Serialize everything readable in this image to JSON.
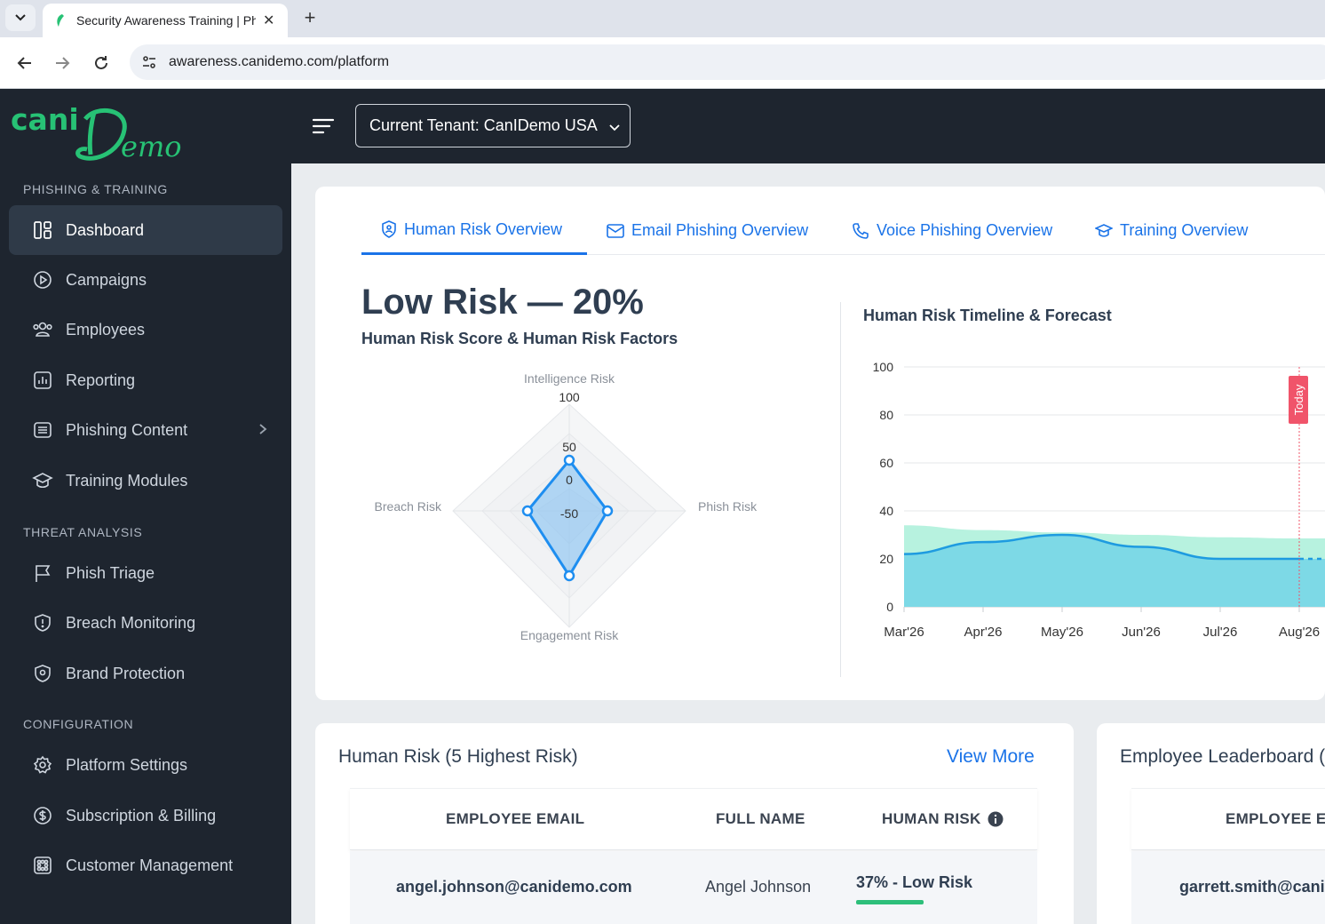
{
  "browser": {
    "tab_title": "Security Awareness Training | Ph",
    "url": "awareness.canidemo.com/platform"
  },
  "header": {
    "logo_text_left": "cani",
    "logo_text_right": "Demo",
    "tenant_label": "Current Tenant: CanIDemo USA"
  },
  "sidebar": {
    "sections": {
      "phishing": "PHISHING & TRAINING",
      "threat": "THREAT ANALYSIS",
      "config": "CONFIGURATION"
    },
    "items": [
      {
        "label": "Dashboard",
        "icon": "dashboard-icon",
        "active": true
      },
      {
        "label": "Campaigns",
        "icon": "play-circle-icon"
      },
      {
        "label": "Employees",
        "icon": "users-icon"
      },
      {
        "label": "Reporting",
        "icon": "report-icon"
      },
      {
        "label": "Phishing Content",
        "icon": "content-icon"
      },
      {
        "label": "Training Modules",
        "icon": "graduation-cap-icon"
      },
      {
        "label": "Phish Triage",
        "icon": "flag-icon"
      },
      {
        "label": "Breach Monitoring",
        "icon": "shield-alert-icon"
      },
      {
        "label": "Brand Protection",
        "icon": "shield-pin-icon"
      },
      {
        "label": "Platform Settings",
        "icon": "gear-icon"
      },
      {
        "label": "Subscription & Billing",
        "icon": "dollar-icon"
      },
      {
        "label": "Customer Management",
        "icon": "grid-icon"
      }
    ]
  },
  "overview_tabs": [
    {
      "label": "Human Risk Overview",
      "active": true
    },
    {
      "label": "Email Phishing Overview"
    },
    {
      "label": "Voice Phishing Overview"
    },
    {
      "label": "Training Overview"
    }
  ],
  "risk": {
    "title": "Low Risk — 20%",
    "subtitle": "Human Risk Score & Human Risk Factors"
  },
  "radar": {
    "axes": [
      "Intelligence Risk",
      "Phish Risk",
      "Engagement Risk",
      "Breach Risk"
    ],
    "ticks": [
      "100",
      "50",
      "0",
      "-50"
    ]
  },
  "timeline": {
    "title": "Human Risk Timeline & Forecast",
    "today_label": "Today"
  },
  "chart_data": {
    "type": "area",
    "x": [
      "Mar'26",
      "Apr'26",
      "May'26",
      "Jun'26",
      "Jul'26",
      "Aug'26"
    ],
    "series": [
      {
        "values": [
          34,
          32,
          31,
          30,
          29,
          28.5
        ],
        "color": "#b7f2df"
      },
      {
        "values": [
          22,
          27,
          30,
          25,
          20,
          20
        ],
        "color": "#7dd9e6"
      }
    ],
    "ylim": [
      0,
      100
    ],
    "yticks": [
      "0",
      "20",
      "40",
      "60",
      "80",
      "100"
    ],
    "today_x": "Aug'26"
  },
  "human_risk_table": {
    "title": "Human Risk (5 Highest Risk)",
    "view_more": "View More",
    "columns": [
      "EMPLOYEE EMAIL",
      "FULL NAME",
      "HUMAN RISK"
    ],
    "rows": [
      {
        "email": "angel.johnson@canidemo.com",
        "name": "Angel Johnson",
        "risk": "37% - Low Risk",
        "risk_fraction": 0.37
      }
    ]
  },
  "leaderboard": {
    "title": "Employee Leaderboard (",
    "column": "EMPLOYEE EM",
    "row_email": "garrett.smith@cani"
  },
  "colors": {
    "accent": "#1a73e8",
    "sidebar_bg": "#1e252f",
    "logo_green": "#27c275",
    "low_risk_bar": "#2dbf7a"
  }
}
